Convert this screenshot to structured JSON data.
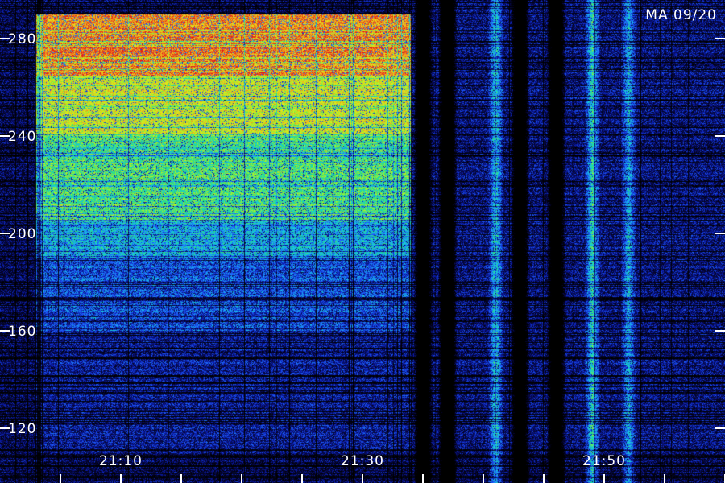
{
  "chart_data": {
    "type": "heatmap",
    "title": "MA 09/20",
    "xlabel": "",
    "ylabel": "",
    "x_ticks": [
      "21:10",
      "21:30",
      "21:50"
    ],
    "x_range_minutes": [
      21.0,
      30.0
    ],
    "y_ticks": [
      120,
      160,
      200,
      240,
      280
    ],
    "y_range": [
      110,
      295
    ],
    "colormap": [
      "#000000",
      "#06063a",
      "#0a1aa8",
      "#1f5cff",
      "#16c8e6",
      "#22e08a",
      "#a8f028",
      "#e8e818",
      "#f08020",
      "#e01818"
    ],
    "intensity_regions": [
      {
        "t_start": "21:03",
        "t_end": "21:34",
        "f_min": 265,
        "f_max": 290,
        "level": 0.85
      },
      {
        "t_start": "21:03",
        "t_end": "21:34",
        "f_min": 240,
        "f_max": 265,
        "level": 0.7
      },
      {
        "t_start": "21:03",
        "t_end": "21:34",
        "f_min": 205,
        "f_max": 240,
        "level": 0.55
      },
      {
        "t_start": "21:03",
        "t_end": "21:34",
        "f_min": 190,
        "f_max": 205,
        "level": 0.4
      },
      {
        "t_start": "21:03",
        "t_end": "21:34",
        "f_min": 160,
        "f_max": 190,
        "level": 0.28
      },
      {
        "t_start": "21:03",
        "t_end": "21:34",
        "f_min": 110,
        "f_max": 160,
        "level": 0.18
      },
      {
        "t_start": "21:34",
        "t_end": "22:00",
        "f_min": 110,
        "f_max": 295,
        "level": 0.15
      }
    ],
    "hot_band": {
      "t_start": "21:04",
      "t_end": "21:21",
      "f_min": 268,
      "f_max": 276,
      "level": 0.95
    },
    "bright_columns": [
      {
        "t": "21:41",
        "level": 0.55
      },
      {
        "t": "21:49",
        "level": 0.6
      },
      {
        "t": "21:52",
        "level": 0.45
      }
    ],
    "dark_columns": [
      "21:35",
      "21:37",
      "21:43",
      "21:46"
    ],
    "colors": {
      "background": "#000000",
      "text": "#ffffff"
    }
  }
}
